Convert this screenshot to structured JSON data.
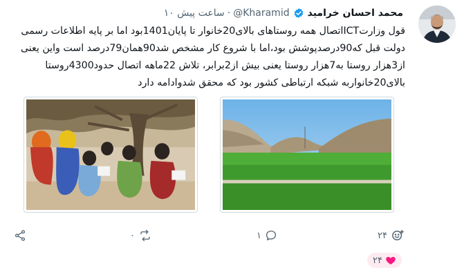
{
  "tweet": {
    "author_name": "محمد احسان خرامید",
    "handle": "@Kharamid",
    "separator": "·",
    "time_ago": "۱۰ ساعت پیش",
    "text": "قول وزارتICTاتصال همه روستاهای بالای20خانوار تا پایان1401بود اما بر پایه اطلاعات رسمی دولت قبل که90درصدپوشش بود،اما با شروع کار مشخص شد90همان79درصد است واین یعنی از3هزار روستا به7هزار روستا یعنی بیش از2برابر، تلاش 22ماهه اتصال حدود4300روستا بالای20خانواربه شبکه ارتباطی کشور بود که محقق شدوادامه دارد"
  },
  "actions": {
    "share_icon": "share-icon",
    "retweet_icon": "retweet-icon",
    "retweet_count": "۰",
    "reply_icon": "reply-icon",
    "reply_count": "۱",
    "react_icon": "add-reaction-icon",
    "react_count": "۲۴",
    "like_icon": "heart-icon",
    "like_count": "۲۴"
  },
  "colors": {
    "verified": "#1d9bf0",
    "like": "#f91880",
    "secondary_text": "#536471"
  }
}
